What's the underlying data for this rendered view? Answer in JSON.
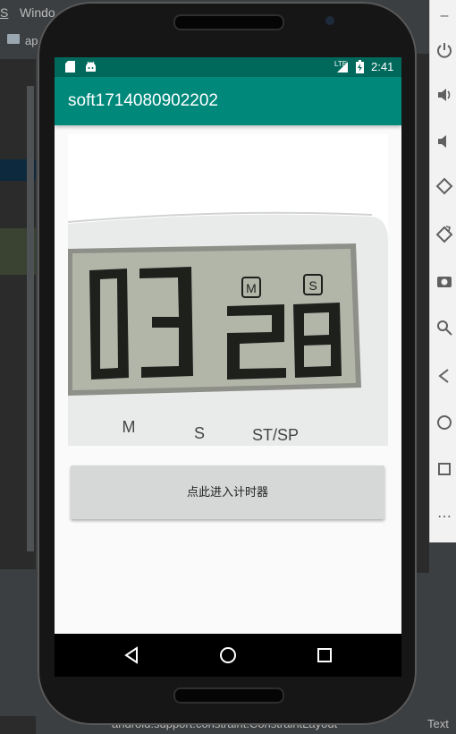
{
  "ide": {
    "menu": [
      {
        "label": "S"
      },
      {
        "label": "Windo"
      }
    ],
    "project_label": "ap",
    "statusbar_text": "android.support.constraint.ConstraintLayout",
    "statusbar_tab": "Text"
  },
  "emulator_toolbar": {
    "items": [
      "minimize-icon",
      "power-icon",
      "volume-up-icon",
      "volume-down-icon",
      "rotate-left-icon",
      "rotate-right-icon",
      "camera-icon",
      "zoom-icon",
      "back-icon",
      "home-icon",
      "overview-icon",
      "more-icon"
    ]
  },
  "device": {
    "status": {
      "time": "2:41",
      "network": "LTE"
    },
    "app": {
      "title": "soft1714080902202",
      "image": {
        "display_digits": "0328",
        "labels": {
          "m_badge": "M",
          "s_badge": "S",
          "m": "M",
          "s": "S",
          "stsp": "ST/SP"
        }
      },
      "button_label": "点此进入计时器"
    }
  },
  "colors": {
    "status_bar": "#00695c",
    "app_bar": "#00897b",
    "ide_bg": "#3c3f41"
  }
}
